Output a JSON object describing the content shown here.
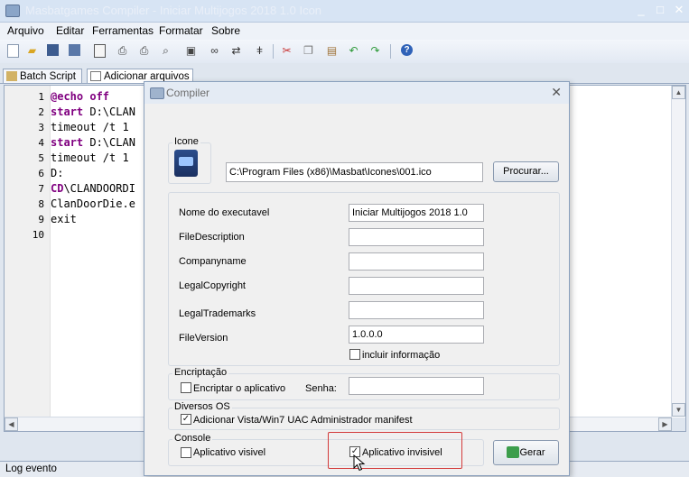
{
  "window": {
    "title": "Masbatgames Compiler - Iniciar Multijogos 2018 1.0 Icon",
    "controls": [
      "_",
      "□",
      "✕"
    ]
  },
  "menu": [
    "Arquivo",
    "Editar",
    "Ferramentas",
    "Formatar",
    "Sobre"
  ],
  "toolbar_icons": [
    "new-file-icon",
    "open-folder-icon",
    "save-icon",
    "save-all-icon",
    "document-icon",
    "print-icon",
    "print-preview-icon",
    "find-icon",
    "find-in-files-icon",
    "search-binoculars-icon",
    "replace-icon",
    "cut-icon",
    "copy-icon",
    "paste-icon",
    "undo-icon",
    "redo-icon",
    "help-icon"
  ],
  "tabs": [
    {
      "label": "Batch Script",
      "icon": "script-icon"
    },
    {
      "label": "Adicionar arquivos",
      "icon": "files-icon"
    }
  ],
  "editor": {
    "lines": [
      {
        "n": "1",
        "text": "@echo off",
        "kw": true
      },
      {
        "n": "2",
        "text": "start D:\\CLAN",
        "kw": false,
        "kwPrefix": "start"
      },
      {
        "n": "3",
        "text": "timeout /t 1",
        "kw": false
      },
      {
        "n": "4",
        "text": "start D:\\CLAN",
        "kw": false,
        "kwPrefix": "start"
      },
      {
        "n": "5",
        "text": "timeout /t 1",
        "kw": false
      },
      {
        "n": "6",
        "text": "D:",
        "kw": false
      },
      {
        "n": "7",
        "text": "CD\\CLANDOORDI",
        "kw": false,
        "kwPrefix": "CD"
      },
      {
        "n": "8",
        "text": "ClanDoorDie.e",
        "kw": false
      },
      {
        "n": "9",
        "text": "exit",
        "kw": false
      },
      {
        "n": "10",
        "text": "",
        "kw": false
      }
    ]
  },
  "log": {
    "label": "Log evento"
  },
  "dialog": {
    "title": "Compiler",
    "icon_group": {
      "legend": "Icone",
      "path": "C:\\Program Files (x86)\\Masbat\\Icones\\001.ico",
      "browse": "Procurar..."
    },
    "fields": [
      {
        "label": "Nome do executavel",
        "value": "Iniciar Multijogos 2018 1.0"
      },
      {
        "label": "FileDescription",
        "value": ""
      },
      {
        "label": "Companyname",
        "value": ""
      },
      {
        "label": "LegalCopyright",
        "value": ""
      },
      {
        "label": "LegalTrademarks",
        "value": ""
      },
      {
        "label": "FileVersion",
        "value": "1.0.0.0"
      }
    ],
    "include_info": {
      "label": "incluir informação",
      "checked": false
    },
    "encrypt": {
      "legend": "Encriptação",
      "label": "Encriptar o aplicativo",
      "checked": false,
      "password_label": "Senha:",
      "password": ""
    },
    "os": {
      "legend": "Diversos OS",
      "label": "Adicionar Vista/Win7 UAC Administrador manifest",
      "checked": true
    },
    "console": {
      "legend": "Console",
      "visible_label": "Aplicativo visivel",
      "visible_checked": false,
      "invisible_label": "Aplicativo invisivel",
      "invisible_checked": true
    },
    "generate": "Gerar",
    "highlight_color": "#d33a3a"
  }
}
